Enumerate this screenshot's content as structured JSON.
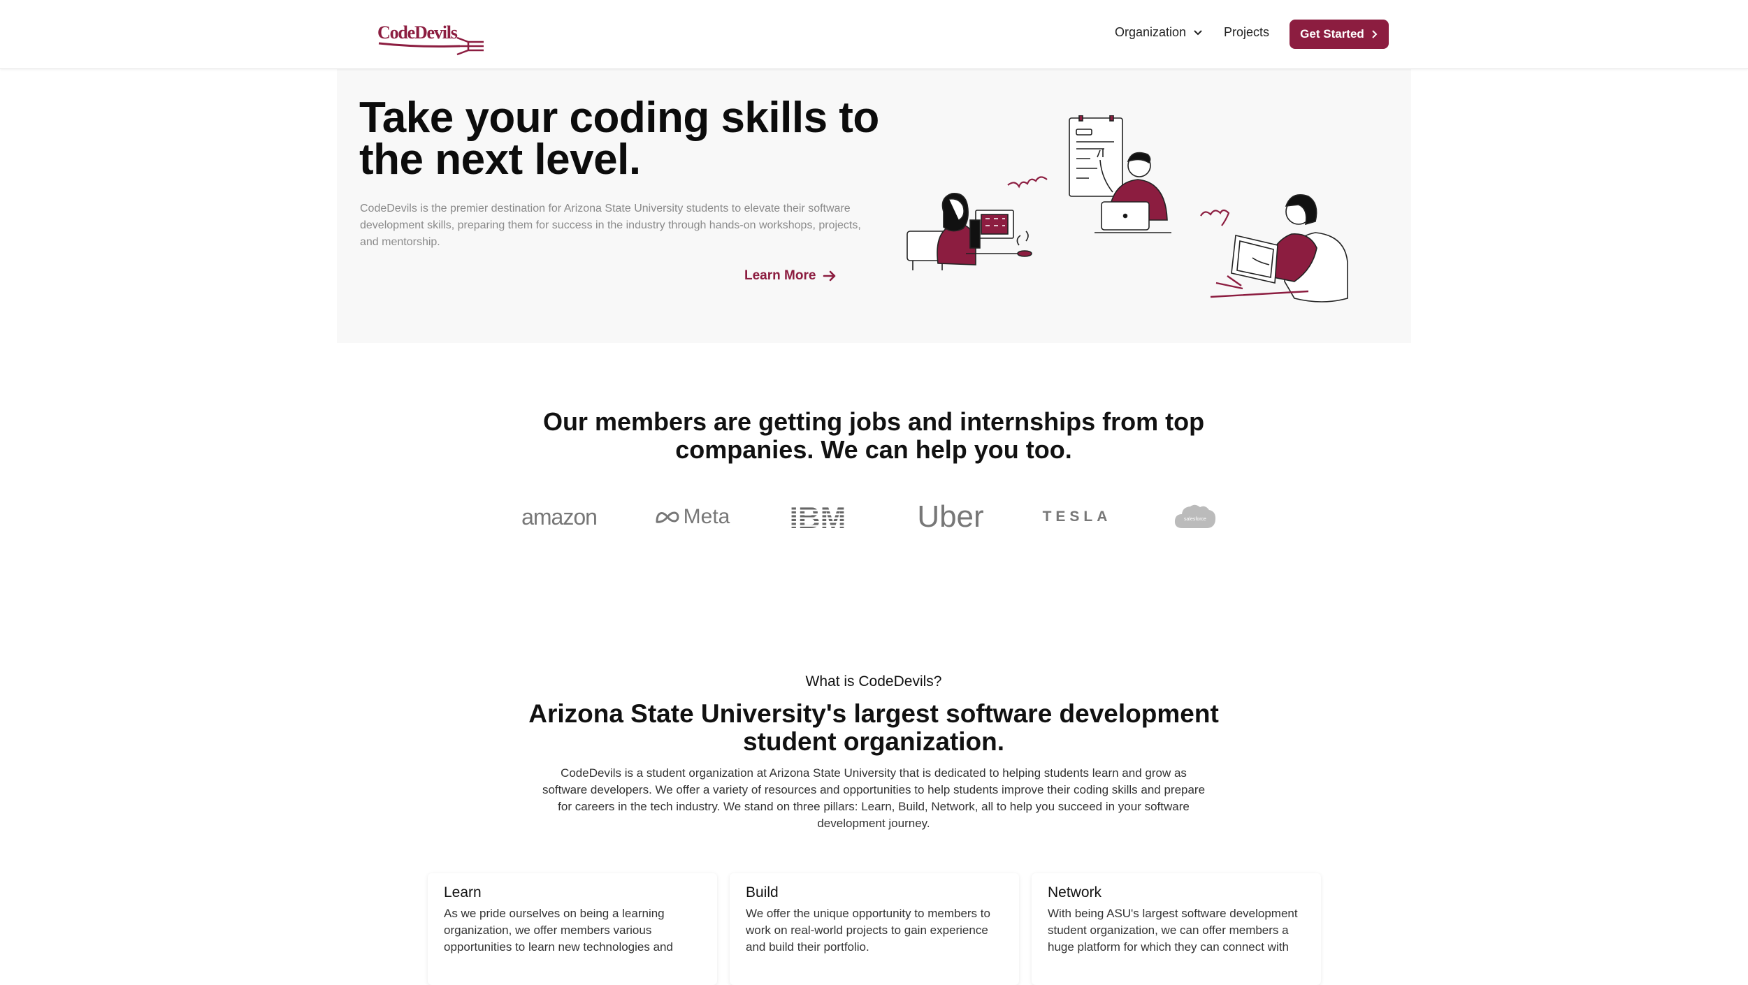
{
  "nav": {
    "logo_text": "CodeDevils",
    "organization_label": "Organization",
    "projects_label": "Projects",
    "get_started_label": "Get Started"
  },
  "hero": {
    "title": "Take your coding skills to the next level.",
    "description": "CodeDevils is the premier destination for Arizona State University students to elevate their software development skills, preparing them for success in the industry through hands-on workshops, projects, and mentorship.",
    "learn_more_label": "Learn More"
  },
  "companies": {
    "title": "Our members are getting jobs and internships from top companies. We can help you too.",
    "logos": [
      {
        "name": "amazon",
        "text": "amazon"
      },
      {
        "name": "meta",
        "text": "Meta"
      },
      {
        "name": "ibm",
        "text": "IBM"
      },
      {
        "name": "uber",
        "text": "Uber"
      },
      {
        "name": "tesla",
        "text": "TESLA"
      },
      {
        "name": "salesforce",
        "text": "salesforce"
      }
    ]
  },
  "about": {
    "kicker": "What is CodeDevils?",
    "title": "Arizona State University's largest software development student organization.",
    "text": "CodeDevils is a student organization at Arizona State University that is dedicated to helping students learn and grow as software developers. We offer a variety of resources and opportunities to help students improve their coding skills and prepare for careers in the tech industry. We stand on three pillars: Learn, Build, Network, all to help you succeed in your software development journey.",
    "pillars": [
      {
        "title": "Learn",
        "text": "As we pride ourselves on being a learning organization, we offer members various opportunities to learn new technologies and"
      },
      {
        "title": "Build",
        "text": "We offer the unique opportunity to members to work on real-world projects to gain experience and build their portfolio."
      },
      {
        "title": "Network",
        "text": "With being ASU's largest software development student organization, we can offer members a huge platform for which they can connect with"
      }
    ]
  },
  "colors": {
    "brand": "#8c1d40",
    "hero_background": "#f8f8f8"
  }
}
